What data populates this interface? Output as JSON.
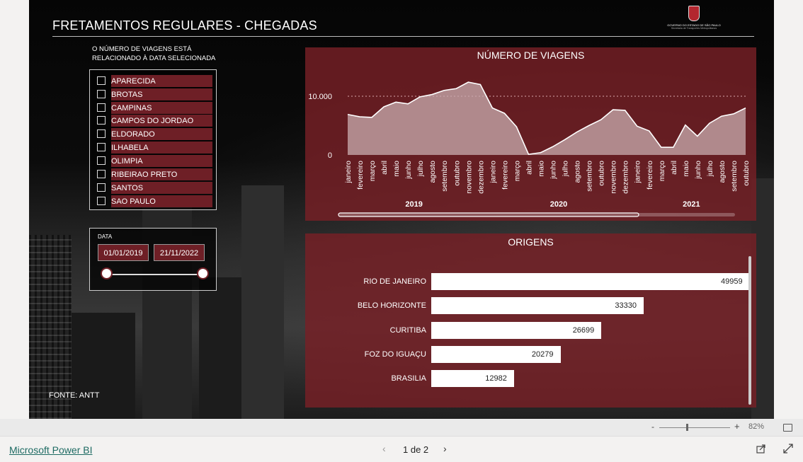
{
  "report": {
    "title": "FRETAMENTOS REGULARES - CHEGADAS",
    "logo": {
      "line1": "GOVERNO DO ESTADO DE SÃO PAULO",
      "line2": "Secretaria de Transportes Metropolitanos"
    },
    "note_line1": "O NÚMERO DE VIAGENS ESTÁ",
    "note_line2": "RELACIONADO À DATA SELECIONADA",
    "source": "FONTE: ANTT"
  },
  "filter": {
    "items": [
      {
        "label": "APARECIDA"
      },
      {
        "label": "BROTAS"
      },
      {
        "label": "CAMPINAS"
      },
      {
        "label": "CAMPOS DO JORDAO"
      },
      {
        "label": "ELDORADO"
      },
      {
        "label": "ILHABELA"
      },
      {
        "label": "OLIMPIA"
      },
      {
        "label": "RIBEIRAO PRETO"
      },
      {
        "label": "SANTOS"
      },
      {
        "label": "SAO PAULO"
      }
    ]
  },
  "date": {
    "label": "DATA",
    "start": "01/01/2019",
    "end": "21/11/2022"
  },
  "chart_data": [
    {
      "type": "area",
      "title": "NÚMERO DE VIAGENS",
      "y_ticks": [
        "0",
        "10.000"
      ],
      "ylim": [
        0,
        13500
      ],
      "color": "#c9aeb0",
      "x": [
        "janeiro",
        "fevereiro",
        "março",
        "abril",
        "maio",
        "junho",
        "julho",
        "agosto",
        "setembro",
        "outubro",
        "novembro",
        "dezembro",
        "janeiro",
        "fevereiro",
        "março",
        "abril",
        "maio",
        "junho",
        "julho",
        "agosto",
        "setembro",
        "outubro",
        "novembro",
        "dezembro",
        "janeiro",
        "fevereiro",
        "março",
        "abril",
        "maio",
        "junho",
        "julho",
        "agosto",
        "setembro",
        "outubro"
      ],
      "years": [
        {
          "label": "2019",
          "first": 0,
          "last": 11
        },
        {
          "label": "2020",
          "first": 12,
          "last": 23
        },
        {
          "label": "2021",
          "first": 24,
          "last": 33
        }
      ],
      "values": [
        6900,
        6500,
        6400,
        8200,
        9000,
        8700,
        9900,
        10300,
        11000,
        11300,
        12400,
        12000,
        8000,
        7100,
        4800,
        100,
        400,
        1400,
        2600,
        3900,
        5000,
        6000,
        7700,
        7600,
        4900,
        4100,
        1300,
        1300,
        5100,
        3200,
        5400,
        6600,
        7000,
        8000
      ]
    },
    {
      "type": "bar",
      "title": "ORIGENS",
      "orientation": "horizontal",
      "categories": [
        "RIO DE JANEIRO",
        "BELO HORIZONTE",
        "CURITIBA",
        "FOZ DO IGUAÇU",
        "BRASILIA"
      ],
      "values": [
        49959,
        33330,
        26699,
        20279,
        12982
      ],
      "xlim": [
        0,
        50000
      ],
      "color": "#ffffff"
    }
  ],
  "statusbar": {
    "zoom_minus": "-",
    "zoom_plus": "+",
    "zoom_level": "82%",
    "zoom_fraction": 0.38
  },
  "footer": {
    "brand_link": "Microsoft Power BI",
    "page_prev": "‹",
    "page_indicator": "1 de 2",
    "page_next": "›"
  },
  "colors": {
    "panel": "#782026",
    "accent": "#6e1f26",
    "link": "#1e6b63"
  }
}
